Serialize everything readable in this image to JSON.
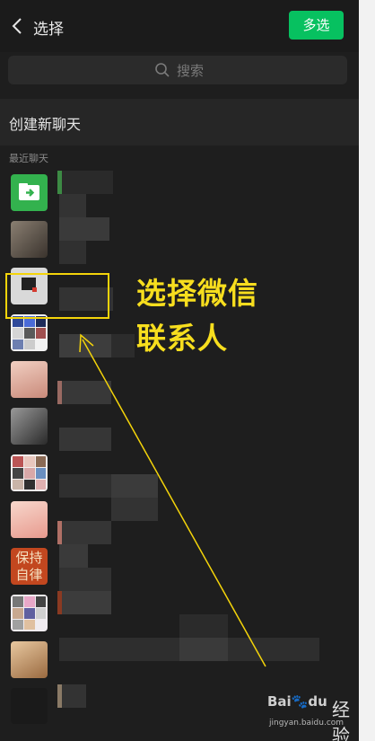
{
  "header": {
    "title": "选择",
    "multi_select": "多选"
  },
  "search": {
    "placeholder": "搜索"
  },
  "create_chat": "创建新聊天",
  "recent_label": "最近聊天",
  "avatars": [
    {
      "icon": "folder-transfer-icon",
      "color": "#33b24e"
    },
    {
      "icon": "avatar-photo",
      "color": "#6e6258"
    },
    {
      "icon": "avatar-photo",
      "color": "#c9c9c9"
    },
    {
      "icon": "avatar-grid",
      "color": "#4a6bd8"
    },
    {
      "icon": "avatar-cartoon",
      "color": "#e8b4a6"
    },
    {
      "icon": "avatar-photo",
      "color": "#777777"
    },
    {
      "icon": "avatar-grid",
      "color": "#e9d3cf"
    },
    {
      "icon": "avatar-cartoon",
      "color": "#f1c6b8"
    },
    {
      "icon": "avatar-text",
      "color": "#c2471f",
      "text": "保持自律"
    },
    {
      "icon": "avatar-grid",
      "color": "#e8e2e8"
    },
    {
      "icon": "avatar-photo",
      "color": "#c08e62"
    }
  ],
  "annotation": {
    "line1": "选择微信",
    "line2": "联系人",
    "color": "#f7de1e"
  },
  "watermark": {
    "brand": "Bai",
    "paw": "du",
    "jingyan": "经验",
    "url": "jingyan.baidu.com"
  }
}
